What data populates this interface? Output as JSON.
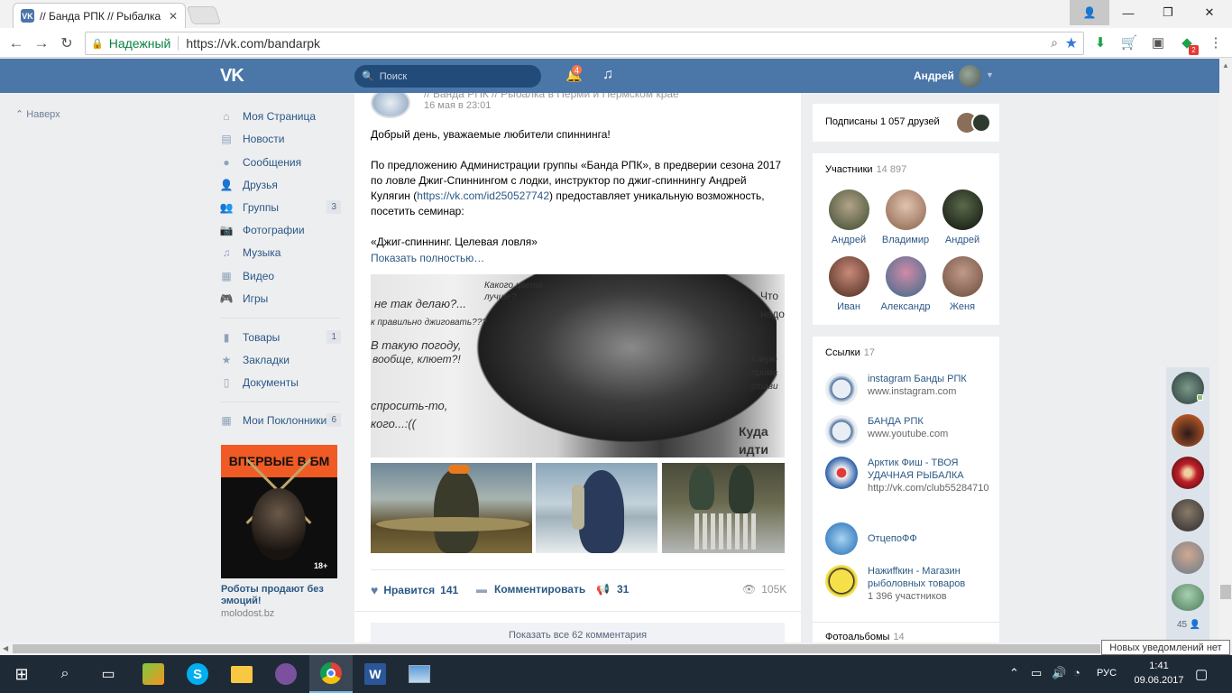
{
  "browser": {
    "tab_title": "// Банда РПК // Рыбалка",
    "tab_favicon": "VK",
    "secure_label": "Надежный",
    "url": "https://vk.com/bandarpk",
    "ext_badge": "2"
  },
  "vk": {
    "search_placeholder": "Поиск",
    "notif_count": "4",
    "user_name": "Андрей"
  },
  "left_menu": {
    "back_up": "Наверх",
    "items": [
      {
        "label": "Моя Страница",
        "count": ""
      },
      {
        "label": "Новости",
        "count": ""
      },
      {
        "label": "Сообщения",
        "count": ""
      },
      {
        "label": "Друзья",
        "count": ""
      },
      {
        "label": "Группы",
        "count": "3"
      },
      {
        "label": "Фотографии",
        "count": ""
      },
      {
        "label": "Музыка",
        "count": ""
      },
      {
        "label": "Видео",
        "count": ""
      },
      {
        "label": "Игры",
        "count": ""
      }
    ],
    "items2": [
      {
        "label": "Товары",
        "count": "1"
      },
      {
        "label": "Закладки",
        "count": ""
      },
      {
        "label": "Документы",
        "count": ""
      }
    ],
    "items3": [
      {
        "label": "Мои Поклонники",
        "count": "6"
      }
    ]
  },
  "ad": {
    "banner_text": "ВПЕРВЫЕ В БМ",
    "age": "18+",
    "title": "Роботы продают без эмоций!",
    "site": "molodost.bz"
  },
  "post": {
    "group_name": "// Банда РПК // Рыбалка в Перми и Пермском крае",
    "date": "16 мая в 23:01",
    "greeting": "Добрый день, уважаемые любители спиннинга!",
    "body_before_link": "По предложению Администрации группы «Банда РПК», в предверии сезона 2017 по ловле Джиг-Спиннингом с лодки, инструктор по джиг-спиннингу Андрей Кулягин (",
    "body_link": "https://vk.com/id250527742",
    "body_after_link": ") предоставляет уникальную возможность, посетить семинар:",
    "seminar": "«Джиг-спиннинг. Целевая ловля»",
    "show_more": "Показать полностью…",
    "image_texts": {
      "t1": "Какого цвета",
      "t1b": "лучше?",
      "t2": "не так делаю?...",
      "t3": "к правильно джиговать???",
      "t4": "В такую погоду,",
      "t5": "вообще, клюет?!",
      "t6": "спросить-то,",
      "t7": "кого...:((",
      "t8": "Что",
      "t9": "надо",
      "t10": "???...",
      "t11": "Какую",
      "t12": "прима",
      "t13": "стави",
      "t14": "Куда",
      "t15": "идти"
    },
    "like_label": "Нравится",
    "like_count": "141",
    "comment_label": "Комментировать",
    "share_count": "31",
    "views": "105K",
    "all_comments": "Показать все 62 комментария"
  },
  "right": {
    "subscribed": "Подписаны 1 057 друзей",
    "members_title": "Участники",
    "members_count": "14 897",
    "members": [
      {
        "name": "Андрей"
      },
      {
        "name": "Владимир"
      },
      {
        "name": "Андрей"
      },
      {
        "name": "Иван"
      },
      {
        "name": "Александр"
      },
      {
        "name": "Женя"
      }
    ],
    "links_title": "Ссылки",
    "links_count": "17",
    "links": [
      {
        "title": "instagram Банды РПК",
        "sub": "www.instagram.com"
      },
      {
        "title": "БАНДА РПК",
        "sub": "www.youtube.com"
      },
      {
        "title": "Арктик Фиш - ТВОЯ УДАЧНАЯ РЫБАЛКА",
        "sub": "http://vk.com/club55284710"
      },
      {
        "title": "ОтцепоФФ",
        "sub": ""
      },
      {
        "title": "Нажиffкин - Магазин рыболовных товаров",
        "sub": "1 396 участников"
      }
    ],
    "albums_title": "Фотоальбомы",
    "albums_count": "14"
  },
  "friends_panel": {
    "count": "45"
  },
  "tooltip": "Новых уведомлений нет",
  "taskbar": {
    "lang": "РУС",
    "time": "1:41",
    "date": "09.06.2017"
  },
  "colors": {
    "vk_blue": "#4a76a8",
    "link": "#2a5885",
    "page_bg": "#edeef0",
    "taskbar": "#1f2a37",
    "ad_orange": "#f05a24"
  }
}
